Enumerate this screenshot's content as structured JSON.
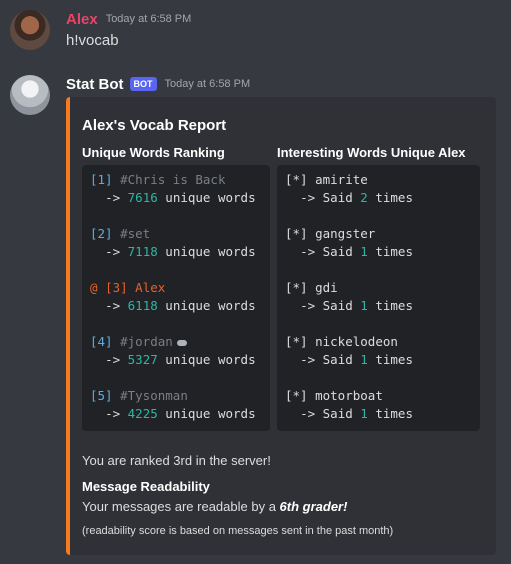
{
  "user_message": {
    "author": "Alex",
    "timestamp": "Today at 6:58 PM",
    "text": "h!vocab",
    "author_color": "#e8446a"
  },
  "bot_message": {
    "author": "Stat Bot",
    "bot_tag": "BOT",
    "timestamp": "Today at 6:58 PM"
  },
  "embed": {
    "accent_color": "#f47b20",
    "title": "Alex's Vocab Report",
    "ranking_header": "Unique Words Ranking",
    "words_header": "Interesting Words Unique Alex",
    "ranking": [
      {
        "prefix": "",
        "rank": "[1]",
        "name": "#Chris is Back",
        "count": "7616",
        "unit": "unique words",
        "highlight": false
      },
      {
        "prefix": "",
        "rank": "[2]",
        "name": "#set",
        "count": "7118",
        "unit": "unique words",
        "highlight": false
      },
      {
        "prefix": "@",
        "rank": "[3]",
        "name": "Alex",
        "count": "6118",
        "unit": "unique words",
        "highlight": true
      },
      {
        "prefix": "",
        "rank": "[4]",
        "name": "#jordan",
        "count": "5327",
        "unit": "unique words",
        "highlight": false
      },
      {
        "prefix": "",
        "rank": "[5]",
        "name": "#Tysonman",
        "count": "4225",
        "unit": "unique words",
        "highlight": false
      }
    ],
    "arrow": "->",
    "words": [
      {
        "marker": "[*]",
        "word": "amirite",
        "said": "Said",
        "count": "2",
        "unit": "times"
      },
      {
        "marker": "[*]",
        "word": "gangster",
        "said": "Said",
        "count": "1",
        "unit": "times"
      },
      {
        "marker": "[*]",
        "word": "gdi",
        "said": "Said",
        "count": "1",
        "unit": "times"
      },
      {
        "marker": "[*]",
        "word": "nickelodeon",
        "said": "Said",
        "count": "1",
        "unit": "times"
      },
      {
        "marker": "[*]",
        "word": "motorboat",
        "said": "Said",
        "count": "1",
        "unit": "times"
      }
    ],
    "rank_summary": "You are ranked 3rd in the server!",
    "readability_title": "Message Readability",
    "readability_text_before": "Your messages are readable by a ",
    "readability_grade": "6th grader!",
    "readability_note": "(readability score is based on messages sent in the past month)"
  }
}
